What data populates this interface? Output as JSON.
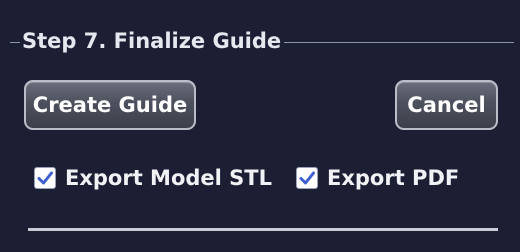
{
  "group": {
    "title": "Step 7. Finalize Guide"
  },
  "buttons": {
    "create_label": "Create Guide",
    "cancel_label": "Cancel"
  },
  "options": [
    {
      "label": "Export Model STL",
      "checked": true
    },
    {
      "label": "Export PDF",
      "checked": true
    }
  ],
  "colors": {
    "panel_background": "#1c1f33",
    "checkbox_mark": "#3f5fd0",
    "text": "#f1f2f6"
  }
}
